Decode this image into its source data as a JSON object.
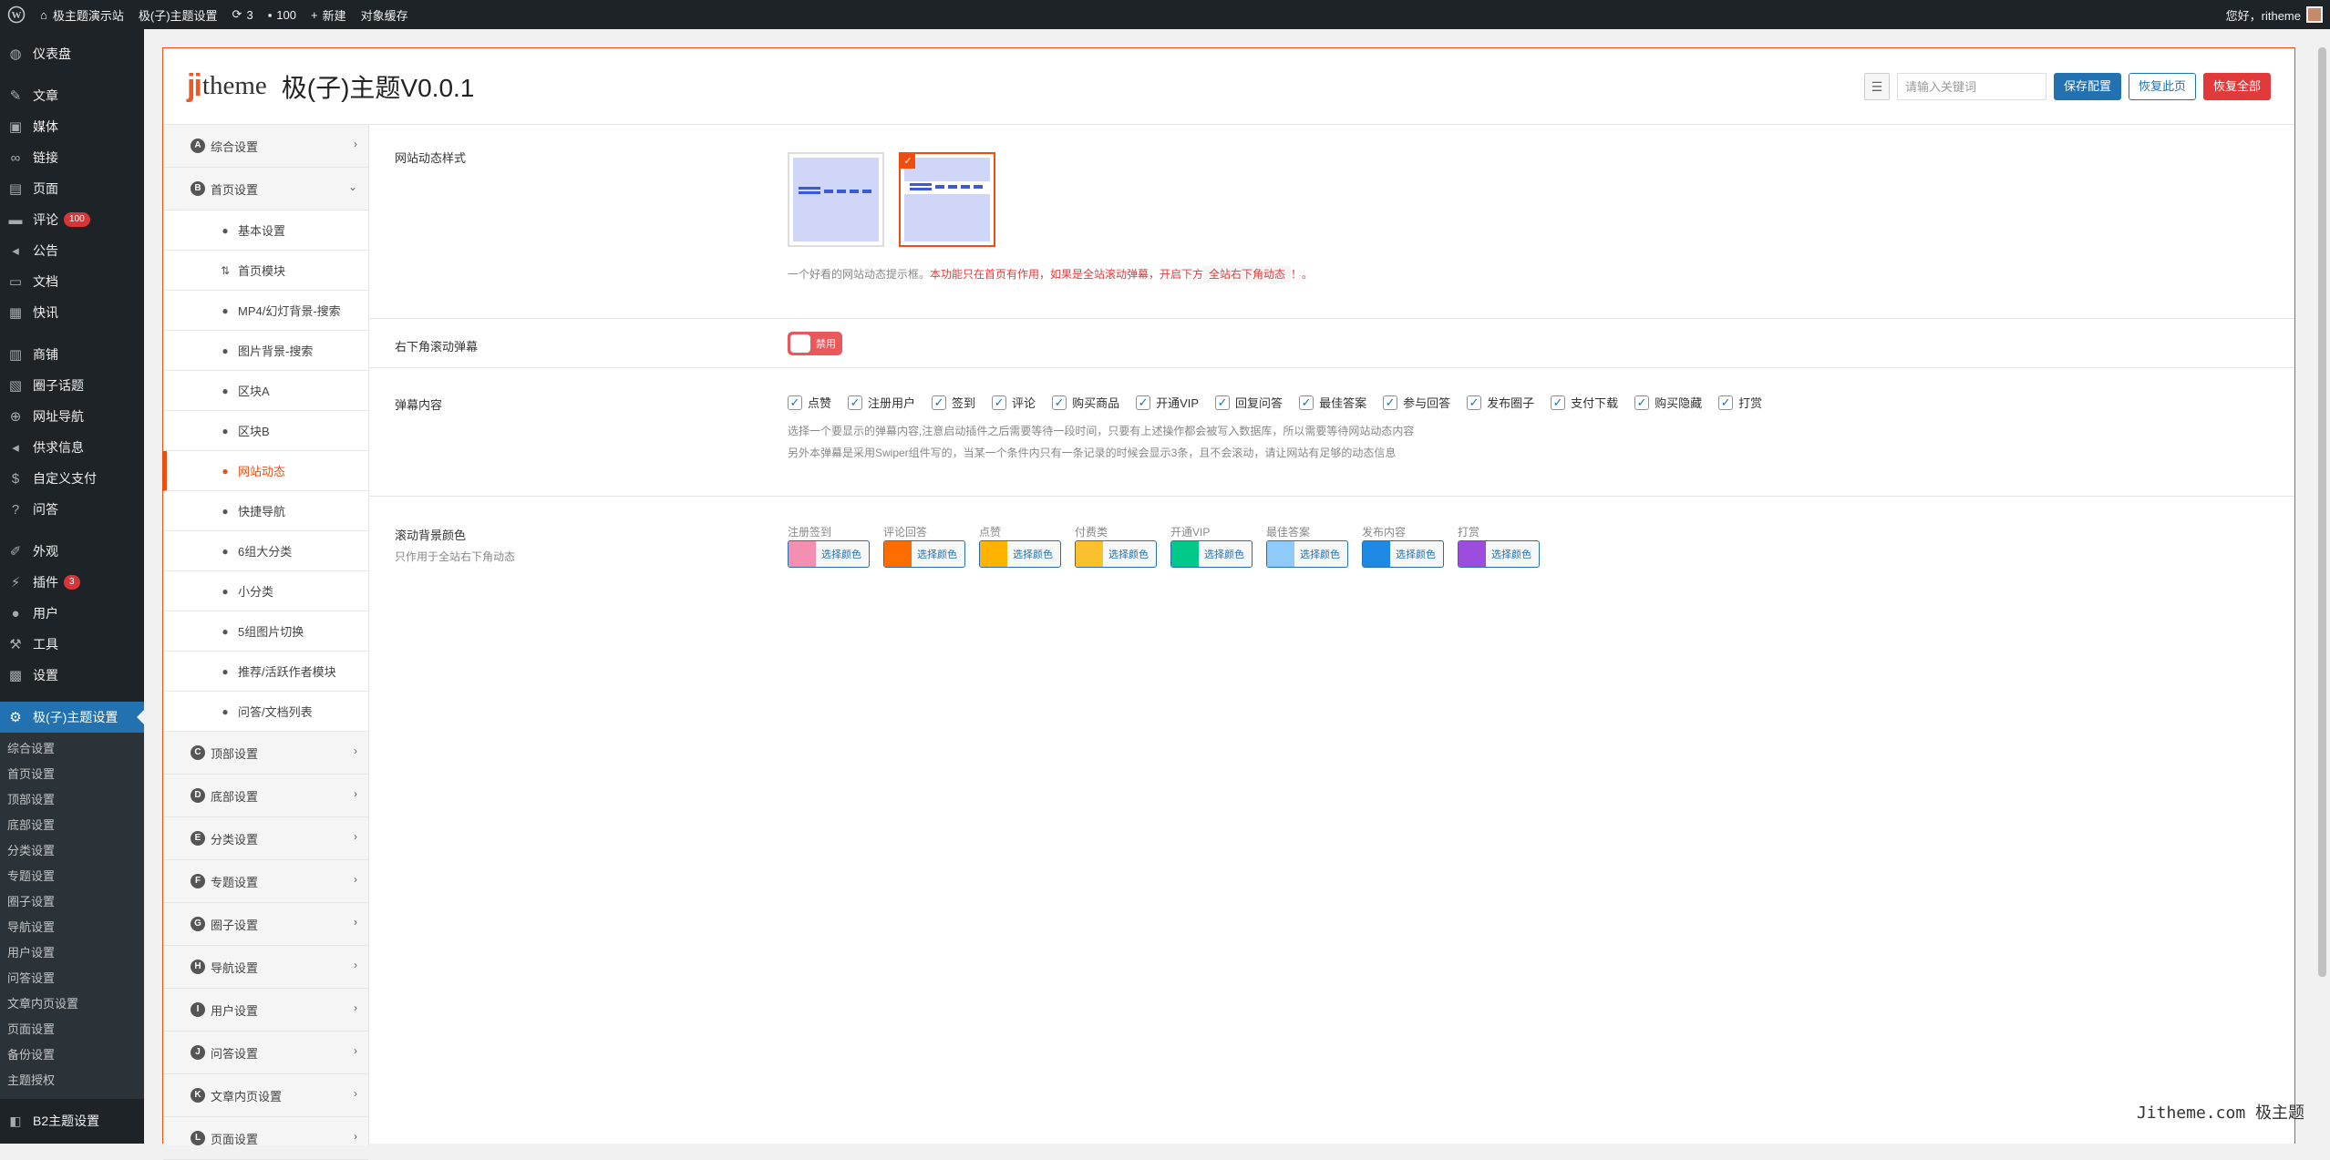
{
  "adminbar": {
    "site_name": "极主题演示站",
    "theme_settings": "极(子)主题设置",
    "updates_count": "3",
    "comments_count": "100",
    "new_label": "新建",
    "cache_label": "对象缓存",
    "greeting": "您好，ritheme"
  },
  "adminmenu": {
    "items": [
      {
        "label": "仪表盘",
        "icon": "dashboard-icon"
      },
      {
        "label": "文章",
        "icon": "pin-icon"
      },
      {
        "label": "媒体",
        "icon": "media-icon"
      },
      {
        "label": "链接",
        "icon": "link-icon"
      },
      {
        "label": "页面",
        "icon": "page-icon"
      },
      {
        "label": "评论",
        "icon": "comment-icon",
        "badge": "100"
      },
      {
        "label": "公告",
        "icon": "megaphone-icon"
      },
      {
        "label": "文档",
        "icon": "document-icon"
      },
      {
        "label": "快讯",
        "icon": "news-icon"
      },
      {
        "label": "商铺",
        "icon": "shop-icon"
      },
      {
        "label": "圈子话题",
        "icon": "topic-icon"
      },
      {
        "label": "网址导航",
        "icon": "globe-icon"
      },
      {
        "label": "供求信息",
        "icon": "megaphone-icon"
      },
      {
        "label": "自定义支付",
        "icon": "dollar-icon"
      },
      {
        "label": "问答",
        "icon": "question-icon"
      },
      {
        "label": "外观",
        "icon": "brush-icon"
      },
      {
        "label": "插件",
        "icon": "plugin-icon",
        "badge": "3"
      },
      {
        "label": "用户",
        "icon": "user-icon"
      },
      {
        "label": "工具",
        "icon": "wrench-icon"
      },
      {
        "label": "设置",
        "icon": "settings-icon"
      }
    ],
    "current": "极(子)主题设置",
    "submenu": [
      "综合设置",
      "首页设置",
      "顶部设置",
      "底部设置",
      "分类设置",
      "专题设置",
      "圈子设置",
      "导航设置",
      "用户设置",
      "问答设置",
      "文章内页设置",
      "页面设置",
      "备份设置",
      "主题授权"
    ],
    "b2": "B2主题设置"
  },
  "header": {
    "logo_ji": "ji",
    "logo_theme": "theme",
    "title": "极(子)主题V0.0.1",
    "search_placeholder": "请输入关键词",
    "save_label": "保存配置",
    "restore_page_label": "恢复此页",
    "restore_all_label": "恢复全部"
  },
  "nav": {
    "sections": [
      {
        "letter": "A",
        "label": "综合设置"
      },
      {
        "letter": "B",
        "label": "首页设置"
      },
      {
        "letter": "C",
        "label": "顶部设置"
      },
      {
        "letter": "D",
        "label": "底部设置"
      },
      {
        "letter": "E",
        "label": "分类设置"
      },
      {
        "letter": "F",
        "label": "专题设置"
      },
      {
        "letter": "G",
        "label": "圈子设置"
      },
      {
        "letter": "H",
        "label": "导航设置"
      },
      {
        "letter": "I",
        "label": "用户设置"
      },
      {
        "letter": "J",
        "label": "问答设置"
      },
      {
        "letter": "K",
        "label": "文章内页设置"
      },
      {
        "letter": "L",
        "label": "页面设置"
      }
    ],
    "home_sub": [
      "基本设置",
      "首页模块",
      "MP4/幻灯背景-搜索",
      "图片背景-搜索",
      "区块A",
      "区块B",
      "网站动态",
      "快捷导航",
      "6组大分类",
      "小分类",
      "5组图片切换",
      "推荐/活跃作者模块",
      "问答/文档列表"
    ],
    "active": "网站动态"
  },
  "fields": {
    "layout": {
      "title": "网站动态样式",
      "desc_gray": "一个好看的网站动态提示框。",
      "desc_red": "本功能只在首页有作用，如果是全站滚动弹幕，开启下方",
      "desc_code": "全站右下角动态",
      "desc_end": "！。"
    },
    "barrage_switch": {
      "title": "右下角滚动弹幕",
      "state": "禁用"
    },
    "content": {
      "title": "弹幕内容",
      "options": [
        "点赞",
        "注册用户",
        "签到",
        "评论",
        "购买商品",
        "开通VIP",
        "回复问答",
        "最佳答案",
        "参与回答",
        "发布圈子",
        "支付下载",
        "购买隐藏",
        "打赏"
      ],
      "desc1": "选择一个要显示的弹幕内容,注意启动插件之后需要等待一段时间，只要有上述操作都会被写入数据库，所以需要等待网站动态内容",
      "desc2": "另外本弹幕是采用Swiper组件写的，当某一个条件内只有一条记录的时候会显示3条，且不会滚动，请让网站有足够的动态信息"
    },
    "colors": {
      "title": "滚动背景颜色",
      "subtitle": "只作用于全站右下角动态",
      "button_text": "选择颜色",
      "items": [
        {
          "label": "注册签到",
          "color": "#f48fb1"
        },
        {
          "label": "评论回答",
          "color": "#ff6d00"
        },
        {
          "label": "点赞",
          "color": "#ffb300"
        },
        {
          "label": "付费类",
          "color": "#fbc02d"
        },
        {
          "label": "开通VIP",
          "color": "#00c98a"
        },
        {
          "label": "最佳答案",
          "color": "#90caf9"
        },
        {
          "label": "发布内容",
          "color": "#1e88e5"
        },
        {
          "label": "打赏",
          "color": "#9c4dde"
        }
      ]
    }
  },
  "watermark": "Jitheme.com 极主题"
}
